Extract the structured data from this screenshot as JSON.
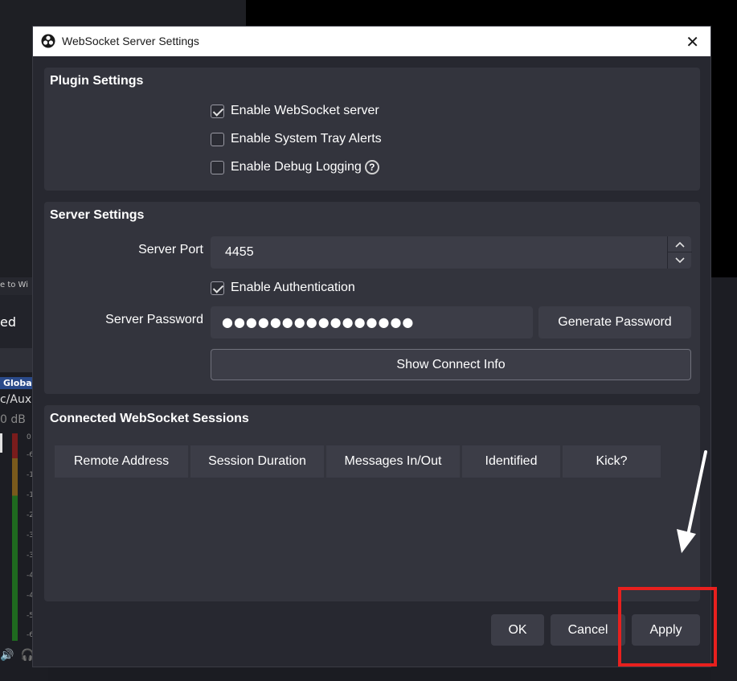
{
  "background": {
    "strip_text": "e to Wi",
    "strip_partial": "ed",
    "mixer": {
      "badge": "Global",
      "label": "c/Aux",
      "db": "0 dB",
      "ticks": [
        "0",
        "-6",
        "-1",
        "-1",
        "-2",
        "-3",
        "-3",
        "-4",
        "-4",
        "-5",
        "-6"
      ]
    }
  },
  "dialog": {
    "title": "WebSocket Server Settings",
    "plugin_settings": {
      "title": "Plugin Settings",
      "enable_server": {
        "label": "Enable WebSocket server",
        "checked": true
      },
      "tray_alerts": {
        "label": "Enable System Tray Alerts",
        "checked": false
      },
      "debug_logging": {
        "label": "Enable Debug Logging",
        "checked": false
      }
    },
    "server_settings": {
      "title": "Server Settings",
      "port_label": "Server Port",
      "port_value": "4455",
      "enable_auth": {
        "label": "Enable Authentication",
        "checked": true
      },
      "password_label": "Server Password",
      "password_value": "●●●●●●●●●●●●●●●●",
      "generate_password": "Generate Password",
      "show_connect_info": "Show Connect Info"
    },
    "sessions": {
      "title": "Connected WebSocket Sessions",
      "columns": [
        "Remote Address",
        "Session Duration",
        "Messages In/Out",
        "Identified",
        "Kick?"
      ]
    },
    "buttons": {
      "ok": "OK",
      "cancel": "Cancel",
      "apply": "Apply"
    }
  },
  "colors": {
    "dialog_bg": "#272830",
    "group_bg": "#33343d",
    "control_bg": "#3c3d47",
    "highlight": "#e8201e"
  }
}
